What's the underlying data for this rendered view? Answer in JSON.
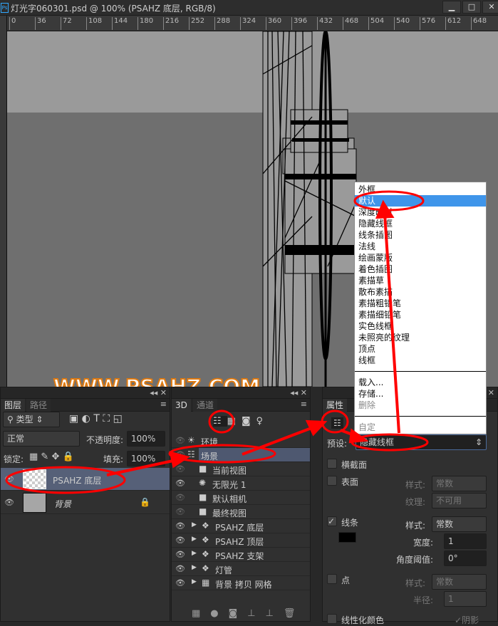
{
  "window": {
    "title": "灯光字060301.psd @ 100% (PSAHZ 底层, RGB/8)",
    "app_icon": "Ps",
    "buttons": [
      "▁",
      "□",
      "✕"
    ]
  },
  "ruler": {
    "ticks": [
      "0",
      "36",
      "72",
      "108",
      "144",
      "180",
      "216",
      "252",
      "288",
      "324",
      "360",
      "396",
      "432",
      "468",
      "504",
      "540",
      "576",
      "612",
      "648"
    ]
  },
  "canvas": {
    "watermark": "WWW.PSAHZ.COM",
    "colors": {
      "upper": "#9a9a9a",
      "lower": "#6f6f6f"
    }
  },
  "layers_panel": {
    "tabs": [
      "图层",
      "路径"
    ],
    "filter": "类型",
    "blend_mode": "正常",
    "opacity_label": "不透明度:",
    "opacity": "100%",
    "lock_label": "锁定:",
    "fill_label": "填充:",
    "fill": "100%",
    "layers": [
      {
        "name": "PSAHZ 底层",
        "selected": true
      },
      {
        "name": "背景",
        "locked": true
      }
    ]
  },
  "panel3d": {
    "tabs": [
      "3D",
      "通道"
    ],
    "items": [
      {
        "name": "环境",
        "icon": "environment-icon",
        "indent": 0,
        "eye": "faint"
      },
      {
        "name": "场景",
        "icon": "scene-icon",
        "indent": 0,
        "selected": true,
        "eye": "faint"
      },
      {
        "name": "当前视图",
        "icon": "camera-icon",
        "indent": 1,
        "eye": "faint"
      },
      {
        "name": "无限光 1",
        "icon": "light-icon",
        "indent": 1,
        "eye": "on"
      },
      {
        "name": "默认相机",
        "icon": "camera-icon",
        "indent": 1,
        "eye": "faint"
      },
      {
        "name": "最终视图",
        "icon": "camera-icon",
        "indent": 1,
        "eye": "faint"
      },
      {
        "name": "PSAHZ 底层",
        "icon": "mesh-icon",
        "indent": 0,
        "expand": true,
        "eye": "on"
      },
      {
        "name": "PSAHZ 顶层",
        "icon": "mesh-icon",
        "indent": 0,
        "expand": true,
        "eye": "on"
      },
      {
        "name": "PSAHZ 支架",
        "icon": "mesh-icon",
        "indent": 0,
        "expand": true,
        "eye": "on"
      },
      {
        "name": "灯管",
        "icon": "mesh-icon",
        "indent": 0,
        "expand": true,
        "eye": "on"
      },
      {
        "name": "背景 拷贝 网格",
        "icon": "grid-icon",
        "indent": 0,
        "expand": true,
        "eye": "on"
      }
    ]
  },
  "properties": {
    "tab": "属性",
    "preset_label": "预设:",
    "preset": "隐藏线框",
    "cross_section": "横截面",
    "surface": {
      "label": "表面",
      "style_label": "样式:",
      "style": "常数",
      "texture_label": "纹理:",
      "texture": "不可用"
    },
    "lines": {
      "label": "线条",
      "checked": true,
      "style_label": "样式:",
      "style": "常数",
      "width_label": "宽度:",
      "width": "1",
      "angle_label": "角度阈值:",
      "angle": "0°",
      "color": "#000000"
    },
    "points": {
      "label": "点",
      "style_label": "样式:",
      "style": "常数",
      "radius_label": "半径:",
      "radius": "1"
    },
    "linearize": "线性化颜色",
    "shadow": "阴影"
  },
  "preset_menu": {
    "items": [
      "外框",
      "默认",
      "深度映射",
      "隐藏线框",
      "线条插图",
      "法线",
      "绘画蒙版",
      "着色插图",
      "素描草",
      "散布素描",
      "素描粗铅笔",
      "素描细铅笔",
      "实色线框",
      "未照亮的纹理",
      "顶点",
      "线框"
    ],
    "selected": "默认",
    "actions": [
      "载入...",
      "存储..."
    ],
    "disabled": [
      "删除",
      "自定"
    ]
  },
  "annotation_color": "#ff0000"
}
